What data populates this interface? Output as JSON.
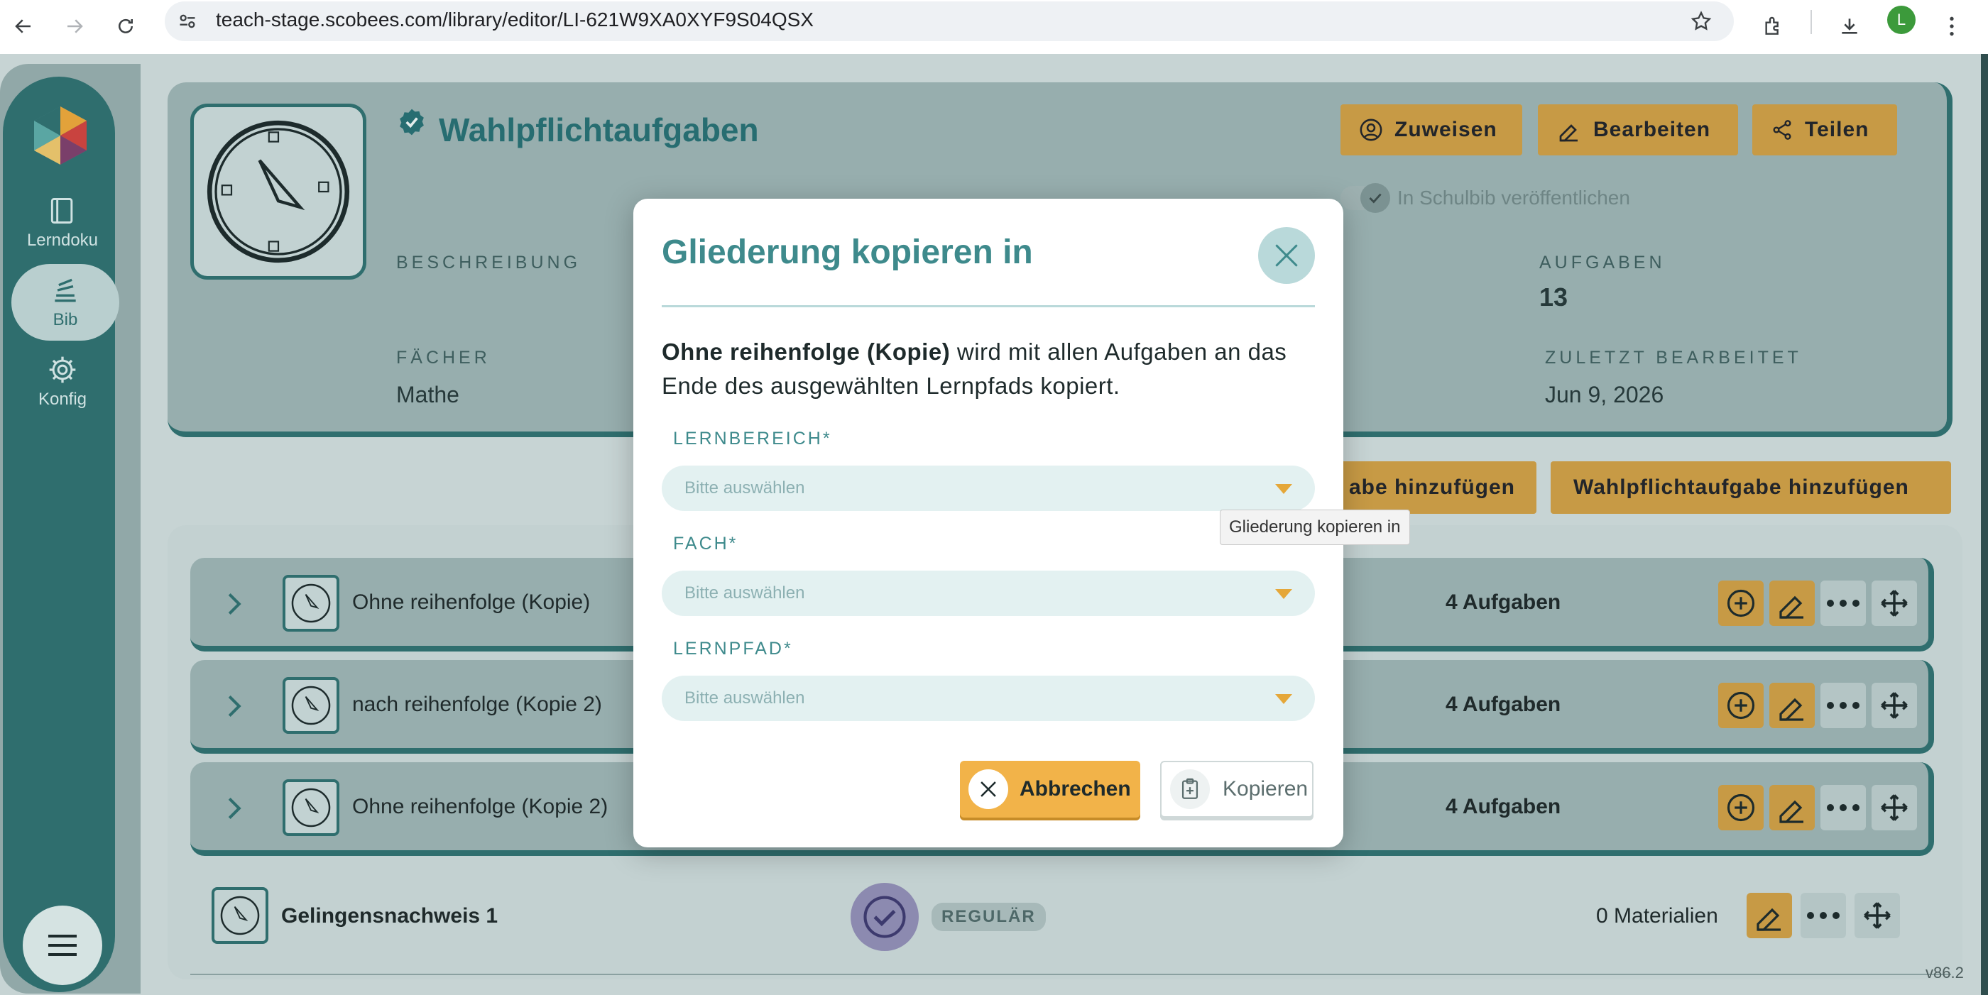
{
  "browser": {
    "url": "teach-stage.scobees.com/library/editor/LI-621W9XA0XYF9S04QSX",
    "profile_initial": "L"
  },
  "sidebar": {
    "items": [
      {
        "label": "Lerndoku",
        "icon": "book-icon"
      },
      {
        "label": "Bib",
        "icon": "library-icon",
        "active": true
      },
      {
        "label": "Konfig",
        "icon": "gear-icon"
      }
    ]
  },
  "header": {
    "title": "Wahlpflichtaufgaben",
    "buttons": {
      "assign": "Zuweisen",
      "edit": "Bearbeiten",
      "share": "Teilen"
    },
    "publish_label": "In Schulbib veröffentlichen",
    "description_label": "BESCHREIBUNG",
    "tasks_label": "AUFGABEN",
    "tasks_value": "13",
    "subjects_label": "FÄCHER",
    "subjects_value": "Mathe",
    "last_edited_label": "ZULETZT BEARBEITET",
    "last_edited_value": "Jun 9, 2026"
  },
  "actions": {
    "add_task_partial": "abe hinzufügen",
    "add_elective": "Wahlpflichtaufgabe hinzufügen"
  },
  "rows": [
    {
      "title": "Ohne reihenfolge (Kopie)",
      "count": "4 Aufgaben"
    },
    {
      "title": "nach reihenfolge (Kopie 2)",
      "count": "4 Aufgaben"
    },
    {
      "title": "Ohne reihenfolge (Kopie 2)",
      "count": "4 Aufgaben"
    }
  ],
  "evidence": {
    "title": "Gelingensnachweis 1",
    "badge": "REGULÄR",
    "materials": "0 Materialien"
  },
  "version": "v86.2",
  "tooltip": "Gliederung kopieren in",
  "modal": {
    "title": "Gliederung kopieren in",
    "text_bold": "Ohne reihenfolge (Kopie)",
    "text_rest": " wird mit allen Aufgaben an das Ende des ausgewählten Lernpfads kopiert.",
    "fields": [
      {
        "label": "LERNBEREICH*",
        "placeholder": "Bitte auswählen"
      },
      {
        "label": "FACH*",
        "placeholder": "Bitte auswählen"
      },
      {
        "label": "LERNPFAD*",
        "placeholder": "Bitte auswählen"
      }
    ],
    "cancel": "Abbrechen",
    "copy": "Kopieren"
  },
  "colors": {
    "teal": "#2f6e6e",
    "accent_gold": "#c79a45",
    "modal_title": "#3e8a8c",
    "cancel_button": "#f2b349"
  }
}
